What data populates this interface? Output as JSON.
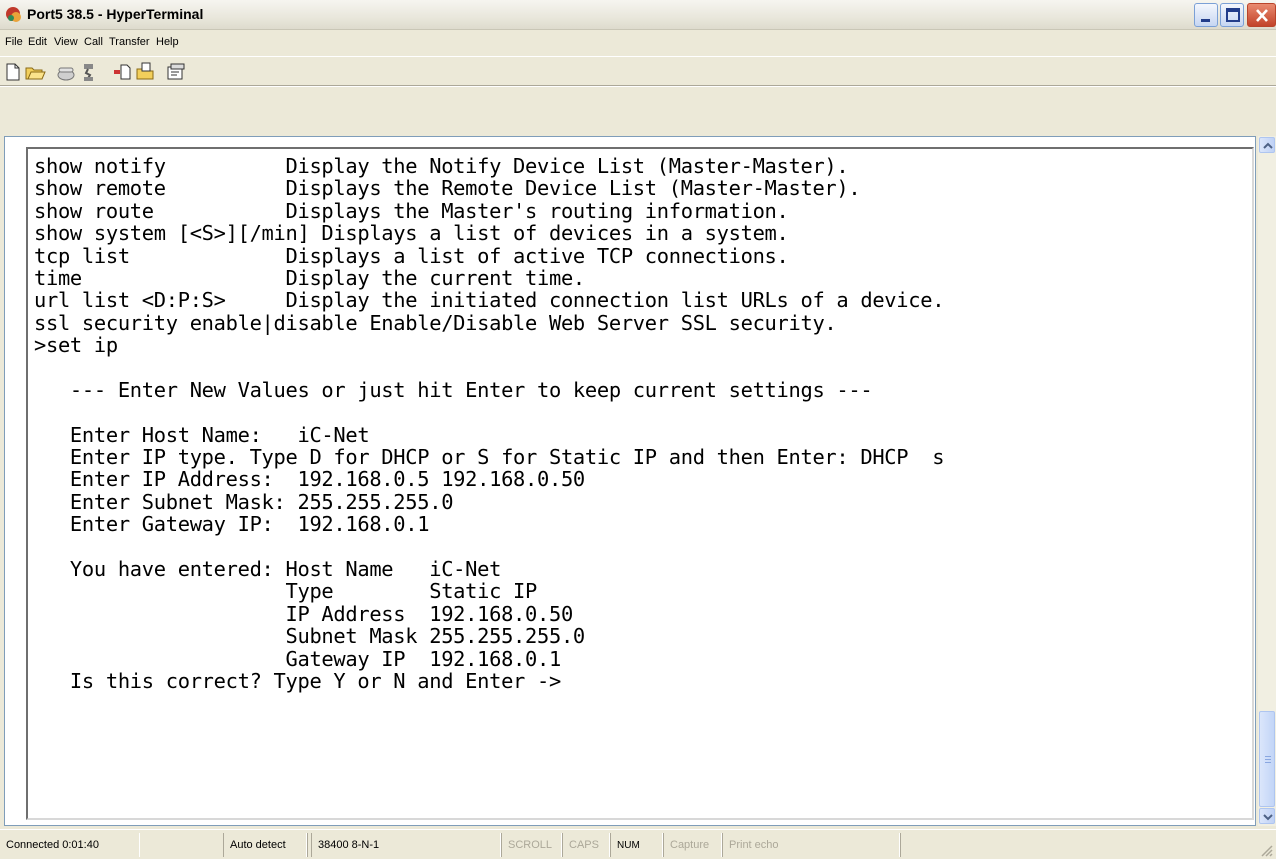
{
  "window": {
    "title": "Port5 38.5 - HyperTerminal"
  },
  "menu": [
    "File",
    "Edit",
    "View",
    "Call",
    "Transfer",
    "Help"
  ],
  "toolbar": {
    "icons": [
      "new-document-icon",
      "open-folder-icon",
      "call-icon",
      "disconnect-icon",
      "send-icon",
      "receive-icon",
      "properties-icon"
    ]
  },
  "terminal": {
    "lines": [
      "show notify          Display the Notify Device List (Master-Master).",
      "show remote          Displays the Remote Device List (Master-Master).",
      "show route           Displays the Master's routing information.",
      "show system [<S>][/min] Displays a list of devices in a system.",
      "tcp list             Displays a list of active TCP connections.",
      "time                 Display the current time.",
      "url list <D:P:S>     Display the initiated connection list URLs of a device.",
      "ssl security enable|disable Enable/Disable Web Server SSL security.",
      ">set ip",
      "",
      "   --- Enter New Values or just hit Enter to keep current settings ---",
      "",
      "   Enter Host Name:   iC-Net",
      "   Enter IP type. Type D for DHCP or S for Static IP and then Enter: DHCP  s",
      "   Enter IP Address:  192.168.0.5 192.168.0.50",
      "   Enter Subnet Mask: 255.255.255.0",
      "   Enter Gateway IP:  192.168.0.1",
      "",
      "   You have entered: Host Name   iC-Net",
      "                     Type        Static IP",
      "                     IP Address  192.168.0.50",
      "                     Subnet Mask 255.255.255.0",
      "                     Gateway IP  192.168.0.1",
      "   Is this correct? Type Y or N and Enter ->"
    ]
  },
  "status_bar": {
    "connected": "Connected 0:01:40",
    "detect": "Auto detect",
    "settings": "38400 8-N-1",
    "scroll": "SCROLL",
    "caps": "CAPS",
    "num": "NUM",
    "capture": "Capture",
    "print_echo": "Print echo"
  },
  "colors": {
    "window_bg": "#ece9d8",
    "terminal_bg": "#ffffff",
    "terminal_text": "#000000",
    "close_button": "#c2432a"
  }
}
